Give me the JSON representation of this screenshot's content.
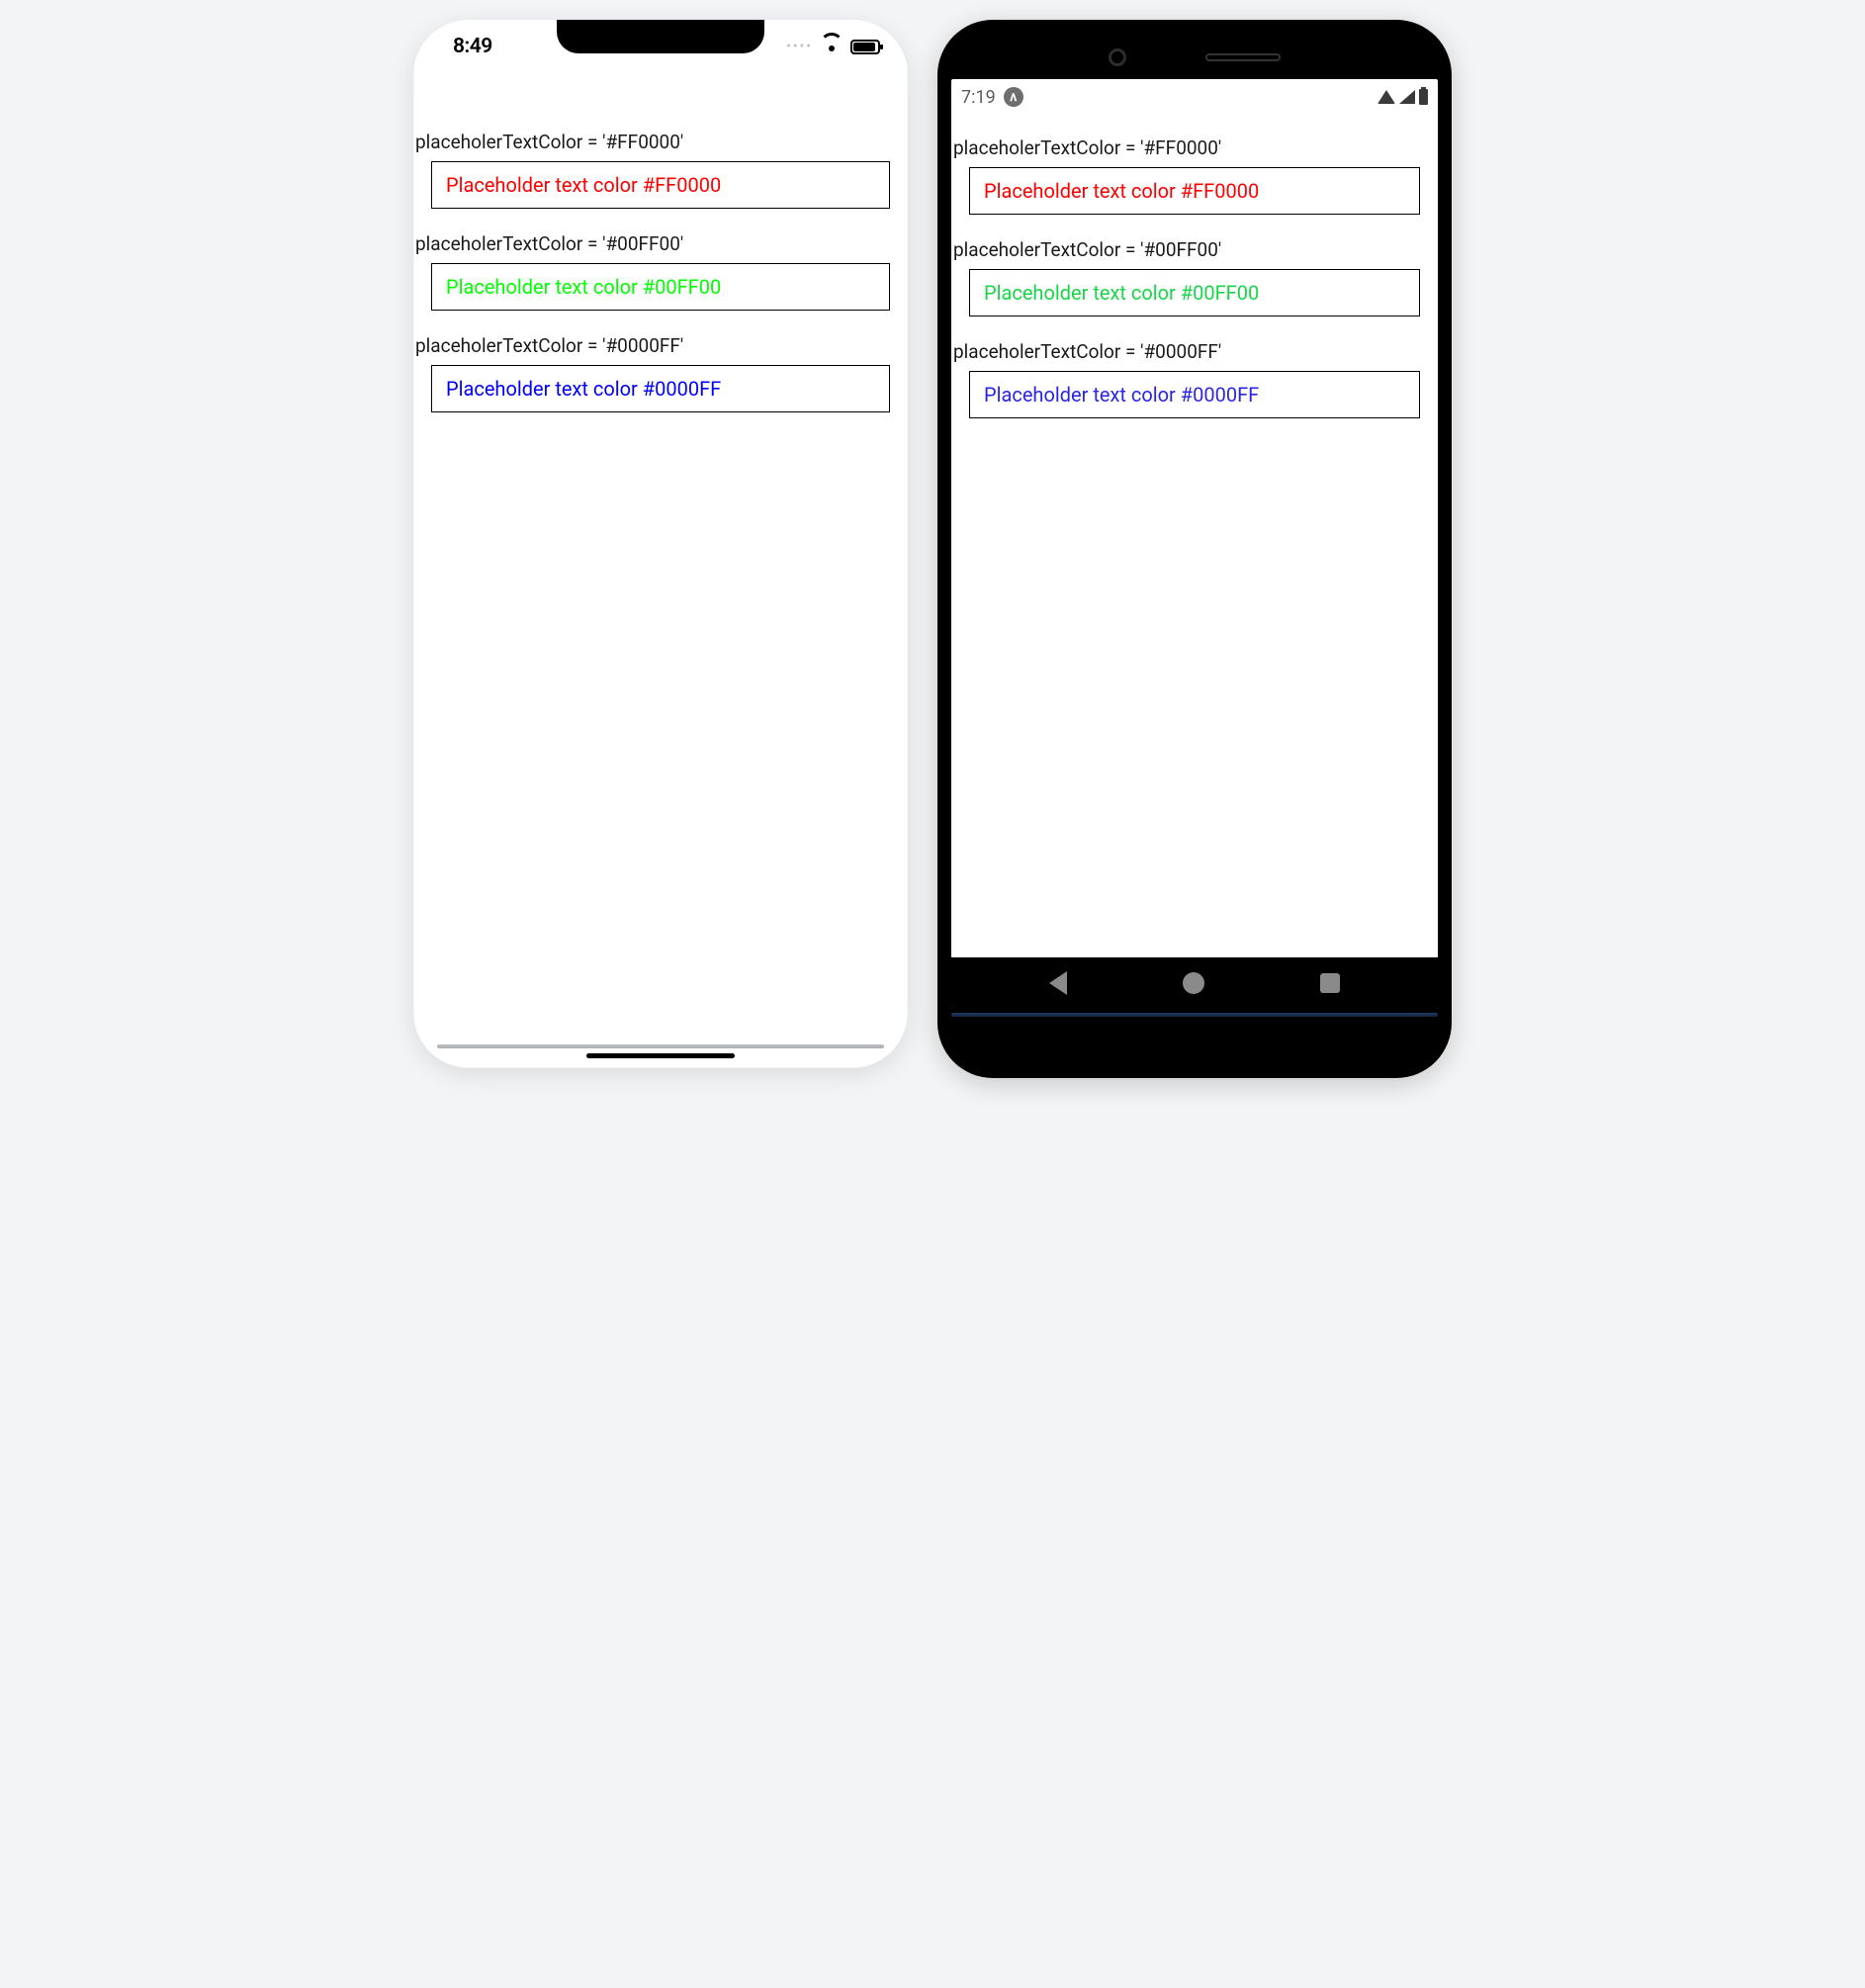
{
  "ios": {
    "time": "8:49",
    "sections": [
      {
        "label": "placeholerTextColor = '#FF0000'",
        "placeholder": "Placeholder text color #FF0000",
        "colorClass": "ph-red"
      },
      {
        "label": "placeholerTextColor = '#00FF00'",
        "placeholder": "Placeholder text color #00FF00",
        "colorClass": "ph-green"
      },
      {
        "label": "placeholerTextColor = '#0000FF'",
        "placeholder": "Placeholder text color #0000FF",
        "colorClass": "ph-blue"
      }
    ]
  },
  "android": {
    "time": "7:19",
    "sections": [
      {
        "label": "placeholerTextColor = '#FF0000'",
        "placeholder": "Placeholder text color #FF0000",
        "colorClass": "ph-red"
      },
      {
        "label": "placeholerTextColor = '#00FF00'",
        "placeholder": "Placeholder text color #00FF00",
        "colorClass": "ph-green-android"
      },
      {
        "label": "placeholerTextColor = '#0000FF'",
        "placeholder": "Placeholder text color #0000FF",
        "colorClass": "ph-blue-android"
      }
    ]
  }
}
